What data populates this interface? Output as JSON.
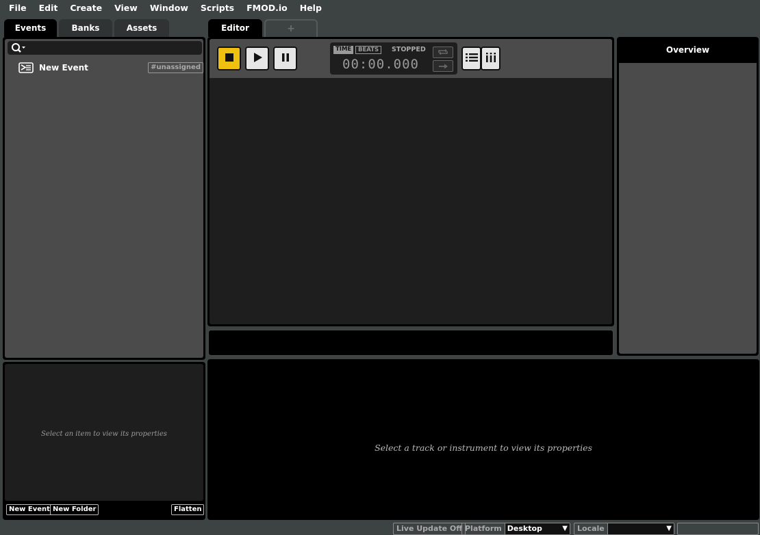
{
  "menu": [
    "File",
    "Edit",
    "Create",
    "View",
    "Window",
    "Scripts",
    "FMOD.io",
    "Help"
  ],
  "browser": {
    "tabs": [
      "Events",
      "Banks",
      "Assets"
    ],
    "search_placeholder": "",
    "items": [
      {
        "label": "New Event",
        "badge": "#unassigned"
      }
    ],
    "properties_hint": "Select an item to view its properties",
    "buttons": {
      "new_event": "New Event",
      "new_folder": "New Folder",
      "flatten": "Flatten"
    }
  },
  "editor": {
    "tab": "Editor",
    "add_tab": "+",
    "transport": {
      "time_label": "TIME",
      "beats_label": "BEATS",
      "status": "STOPPED",
      "clock": "00:00.000"
    }
  },
  "overview": {
    "title": "Overview"
  },
  "deck": {
    "hint": "Select a track or instrument to view its properties"
  },
  "statusbar": {
    "live_update": "Live Update Off",
    "platform_label": "Platform",
    "platform_value": "Desktop",
    "locale_label": "Locale",
    "locale_value": ""
  },
  "colors": {
    "accent_stop": "#f0c010",
    "panel": "#000000",
    "background": "#3d4242"
  }
}
